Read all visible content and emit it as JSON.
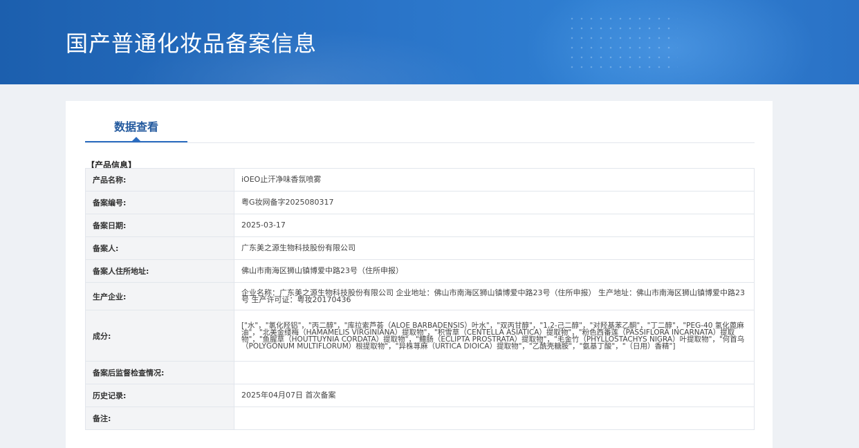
{
  "page_title": "国产普通化妆品备案信息",
  "tab": {
    "label": "数据查看"
  },
  "section_title": "【产品信息】",
  "rows": [
    {
      "label": "产品名称:",
      "value": "iOEO止汗净味香氛喷雾"
    },
    {
      "label": "备案编号:",
      "value": "粤G妆网备字2025080317"
    },
    {
      "label": "备案日期:",
      "value": "2025-03-17"
    },
    {
      "label": "备案人:",
      "value": "广东美之源生物科技股份有限公司"
    },
    {
      "label": "备案人住所地址:",
      "value": "佛山市南海区狮山镇博爱中路23号（住所申报）"
    },
    {
      "label": "生产企业:",
      "value": "企业名称：广东美之源生物科技股份有限公司 企业地址：佛山市南海区狮山镇博爱中路23号（住所申报） 生产地址：佛山市南海区狮山镇博爱中路23号 生产许可证：粤妆20170436"
    },
    {
      "label": "成分:",
      "value": "[\"水\"，\"氯化羟铝\"，\"丙二醇\"，\"库拉索芦荟（ALOE BARBADENSIS）叶水\"，\"双丙甘醇\"，\"1,2-己二醇\"，\"对羟基苯乙酮\"，\"丁二醇\"，\"PEG-40 氢化蓖麻油\"，\"北美金缕梅（HAMAMELIS VIRGINIANA）提取物\"，\"积雪草（CENTELLA ASIATICA）提取物\"，\"粉色西番莲（PASSIFLORA INCARNATA）提取物\"，\"鱼腥草（HOUTTUYNIA CORDATA）提取物\"，\"鳢肠（ECLIPTA PROSTRATA）提取物\"，\"毛金竹（PHYLLOSTACHYS NIGRA）叶提取物\"，\"何首乌（POLYGONUM MULTIFLORUM）根提取物\"，\"异株荨麻（URTICA DIOICA）提取物\"，\"乙酰壳糖胺\"，\"氨基丁酸\"，\"（日用）香精\"]"
    },
    {
      "label": "备案后监督检查情况:",
      "value": ""
    },
    {
      "label": "历史记录:",
      "value": "2025年04月07日 首次备案"
    },
    {
      "label": "备注:",
      "value": ""
    }
  ]
}
